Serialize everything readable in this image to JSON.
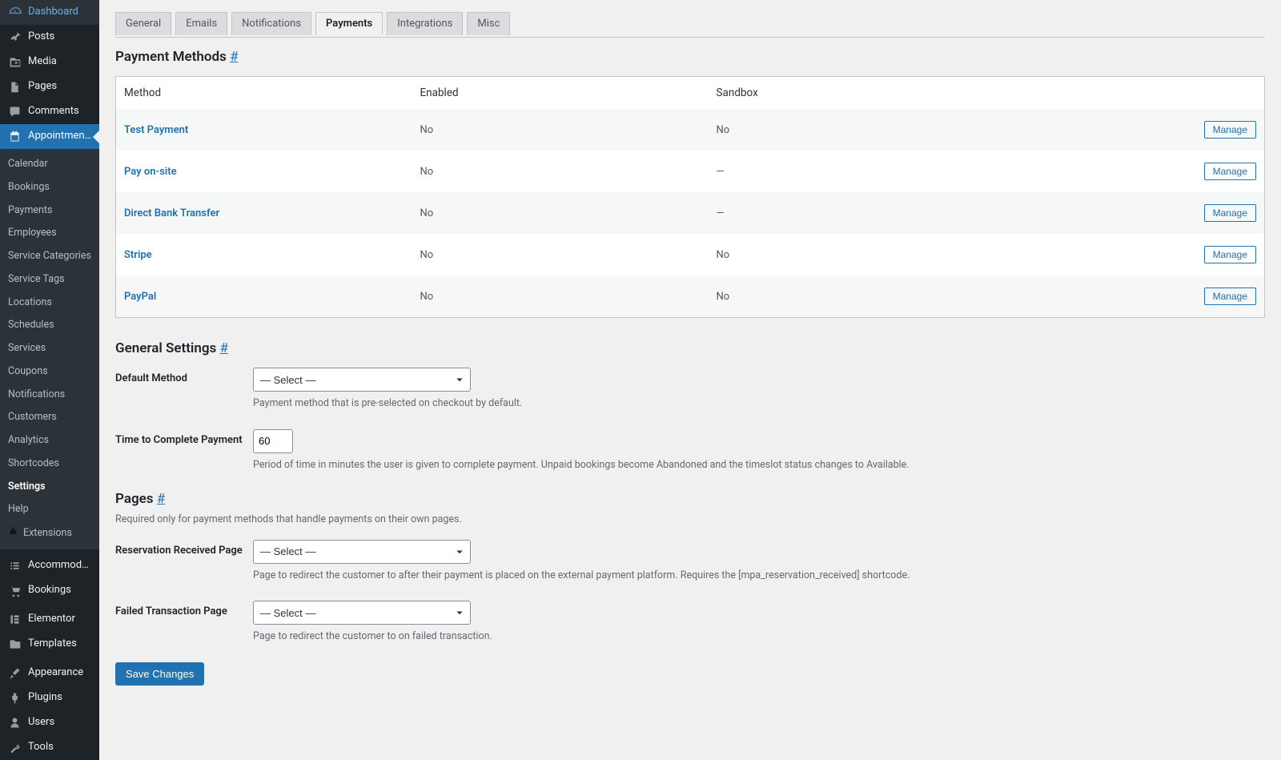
{
  "sidebar": {
    "items": [
      {
        "id": "dashboard",
        "label": "Dashboard",
        "icon": "gauge"
      },
      {
        "id": "posts",
        "label": "Posts",
        "icon": "pin"
      },
      {
        "id": "media",
        "label": "Media",
        "icon": "media"
      },
      {
        "id": "pages",
        "label": "Pages",
        "icon": "pages"
      },
      {
        "id": "comments",
        "label": "Comments",
        "icon": "comments"
      },
      {
        "id": "appointments",
        "label": "Appointments",
        "icon": "calendar",
        "current": true
      },
      {
        "id": "accommodation",
        "label": "Accommodation",
        "icon": "list"
      },
      {
        "id": "bookings",
        "label": "Bookings",
        "icon": "cart"
      },
      {
        "id": "elementor",
        "label": "Elementor",
        "icon": "elementor"
      },
      {
        "id": "templates",
        "label": "Templates",
        "icon": "folder"
      },
      {
        "id": "appearance",
        "label": "Appearance",
        "icon": "brush"
      },
      {
        "id": "plugins",
        "label": "Plugins",
        "icon": "plug"
      },
      {
        "id": "users",
        "label": "Users",
        "icon": "user"
      },
      {
        "id": "tools",
        "label": "Tools",
        "icon": "wrench"
      }
    ],
    "submenu": [
      "Calendar",
      "Bookings",
      "Payments",
      "Employees",
      "Service Categories",
      "Service Tags",
      "Locations",
      "Schedules",
      "Services",
      "Coupons",
      "Notifications",
      "Customers",
      "Analytics",
      "Shortcodes",
      "Settings",
      "Help",
      "Extensions"
    ],
    "submenu_current": "Settings",
    "submenu_extensions_index": 16
  },
  "tabs": [
    "General",
    "Emails",
    "Notifications",
    "Payments",
    "Integrations",
    "Misc"
  ],
  "active_tab": "Payments",
  "sections": {
    "methods": {
      "title": "Payment Methods",
      "hash": "#"
    },
    "general": {
      "title": "General Settings",
      "hash": "#"
    },
    "pages": {
      "title": "Pages",
      "hash": "#"
    }
  },
  "methods_table": {
    "headers": {
      "method": "Method",
      "enabled": "Enabled",
      "sandbox": "Sandbox"
    },
    "manage_label": "Manage",
    "rows": [
      {
        "method": "Test Payment",
        "enabled": "No",
        "sandbox": "No"
      },
      {
        "method": "Pay on-site",
        "enabled": "No",
        "sandbox": "—"
      },
      {
        "method": "Direct Bank Transfer",
        "enabled": "No",
        "sandbox": "—"
      },
      {
        "method": "Stripe",
        "enabled": "No",
        "sandbox": "No"
      },
      {
        "method": "PayPal",
        "enabled": "No",
        "sandbox": "No"
      }
    ]
  },
  "general_settings": {
    "default_method": {
      "label": "Default Method",
      "placeholder": "— Select —",
      "desc": "Payment method that is pre-selected on checkout by default."
    },
    "time_to_complete": {
      "label": "Time to Complete Payment",
      "value": "60",
      "desc": "Period of time in minutes the user is given to complete payment. Unpaid bookings become Abandoned and the timeslot status changes to Available."
    }
  },
  "pages_settings": {
    "note": "Required only for payment methods that handle payments on their own pages.",
    "reservation_page": {
      "label": "Reservation Received Page",
      "placeholder": "— Select —",
      "desc": "Page to redirect the customer to after their payment is placed on the external payment platform. Requires the [mpa_reservation_received] shortcode."
    },
    "failed_page": {
      "label": "Failed Transaction Page",
      "placeholder": "— Select —",
      "desc": "Page to redirect the customer to on failed transaction."
    }
  },
  "save_button": "Save Changes"
}
